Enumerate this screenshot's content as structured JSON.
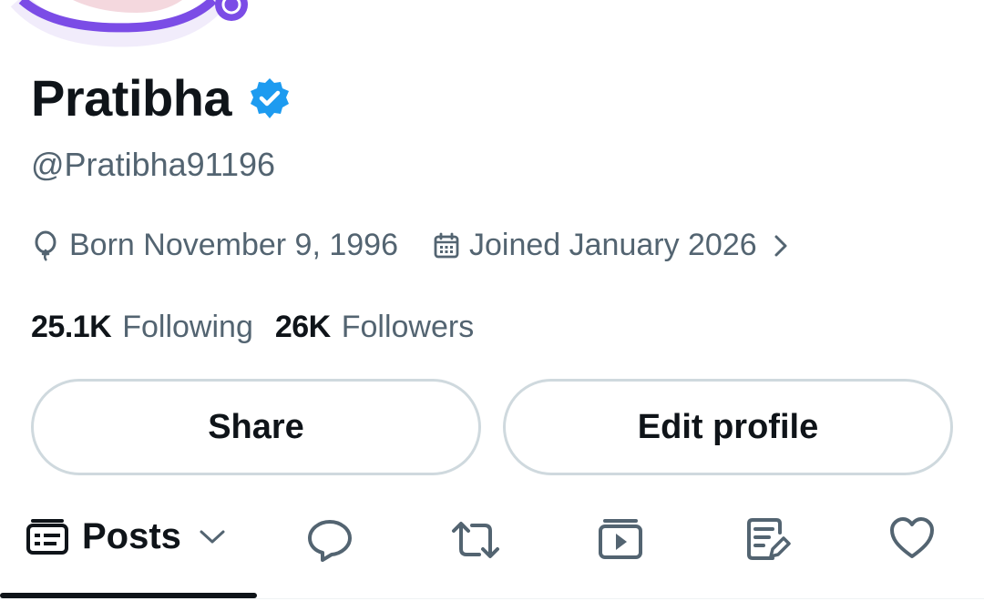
{
  "profile": {
    "name": "Pratibha",
    "handle": "@Pratibha91196",
    "born": "Born November 9, 1996",
    "joined": "Joined January 2026",
    "following_count": "25.1K",
    "following_label": "Following",
    "followers_count": "26K",
    "followers_label": "Followers"
  },
  "buttons": {
    "share": "Share",
    "edit_profile": "Edit profile"
  },
  "tabs": {
    "posts_label": "Posts",
    "icons": [
      "posts-feed-icon",
      "reply-icon",
      "repost-icon",
      "video-icon",
      "articles-icon",
      "like-icon"
    ]
  },
  "colors": {
    "verified": "#1d9bf0",
    "avatar_ring": "#7b4ce6",
    "secondary_text": "#536471"
  }
}
